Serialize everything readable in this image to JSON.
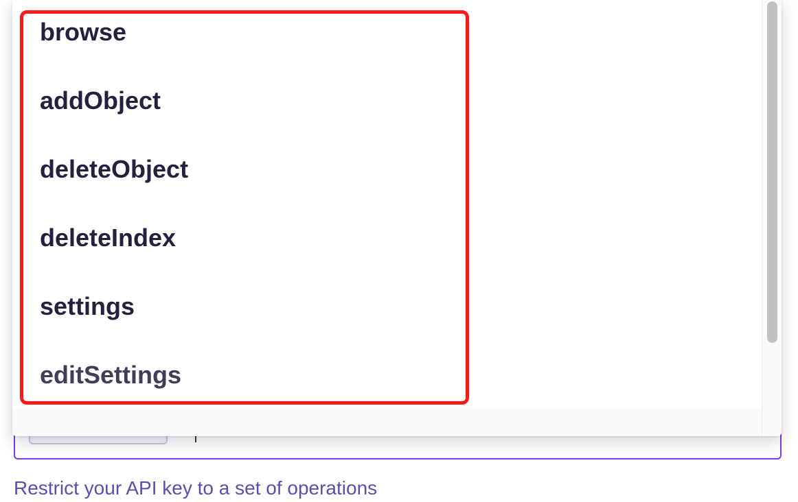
{
  "dropdown": {
    "options": [
      {
        "label": "browse"
      },
      {
        "label": "addObject"
      },
      {
        "label": "deleteObject"
      },
      {
        "label": "deleteIndex"
      },
      {
        "label": "settings"
      },
      {
        "label": "editSettings"
      }
    ]
  },
  "field": {
    "helper_text": "Restrict your API key to a set of operations"
  },
  "colors": {
    "accent": "#7c3aed",
    "highlight": "#ff1a1a",
    "option_text": "#23213d",
    "helper_text": "#5a4fa8"
  }
}
